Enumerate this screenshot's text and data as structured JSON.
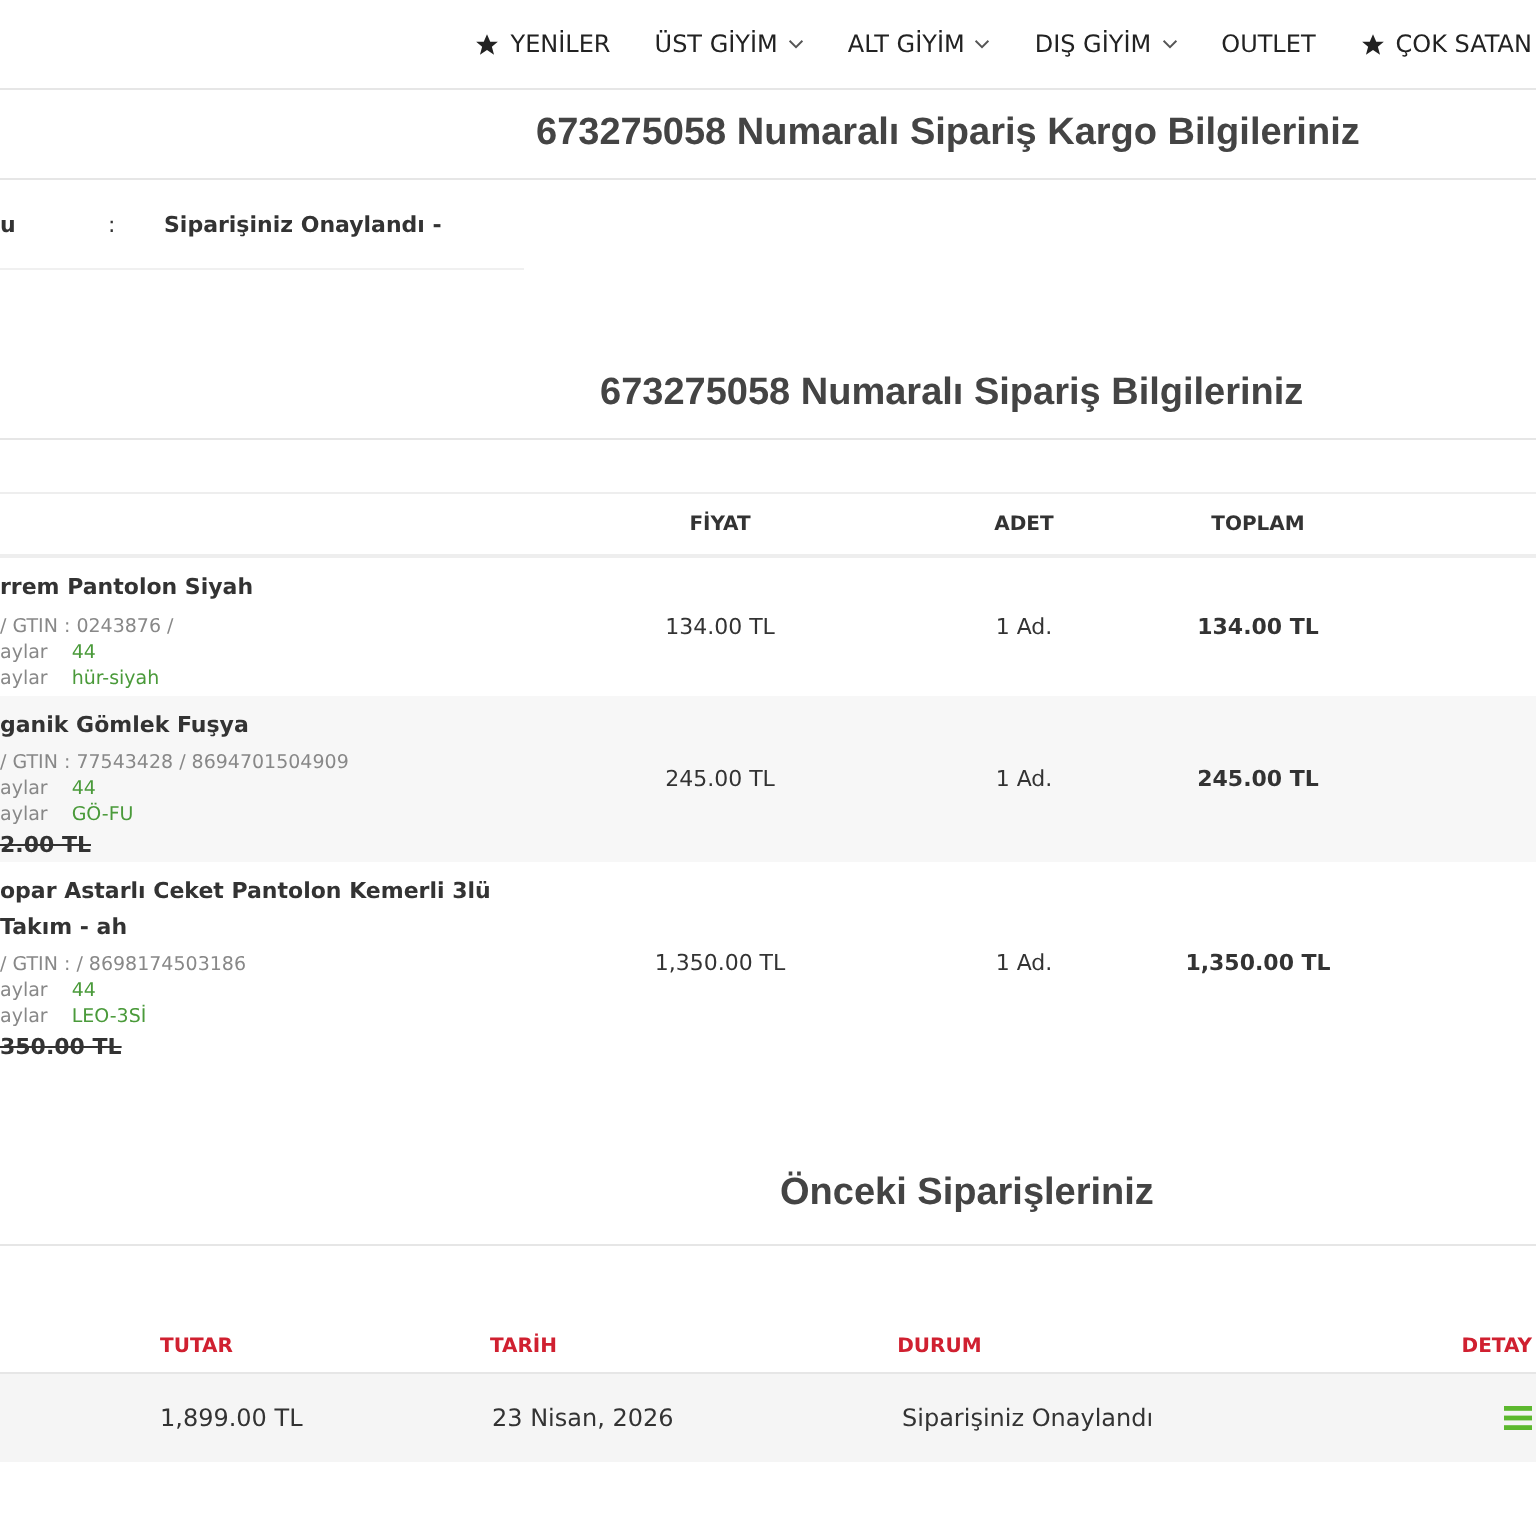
{
  "nav": [
    {
      "label": "YENİLER",
      "kind": "star"
    },
    {
      "label": "ÜST GİYİM",
      "kind": "dropdown"
    },
    {
      "label": "ALT GİYİM",
      "kind": "dropdown"
    },
    {
      "label": "DIŞ GİYİM",
      "kind": "dropdown"
    },
    {
      "label": "OUTLET",
      "kind": "plain"
    },
    {
      "label": "ÇOK SATAN",
      "kind": "star"
    }
  ],
  "cargo": {
    "title": "673275058 Numaralı Sipariş Kargo Bilgileriniz",
    "label": "u",
    "separator": ":",
    "value": "Siparişiniz Onaylandı -"
  },
  "order": {
    "title": "673275058 Numaralı Sipariş Bilgileriniz",
    "columns": [
      "FİYAT",
      "ADET",
      "TOPLAM"
    ],
    "rows": [
      {
        "name": "rrem Pantolon Siyah",
        "code": "/ GTIN : 0243876 /",
        "attributes": [
          {
            "label": "aylar",
            "value": "44"
          },
          {
            "label": "aylar",
            "value": "hür-siyah"
          }
        ],
        "old_price": "",
        "price": "134.00 TL",
        "qty": "1 Ad.",
        "total": "134.00 TL"
      },
      {
        "name": "ganik Gömlek Fuşya",
        "code": "/ GTIN : 77543428 / 8694701504909",
        "attributes": [
          {
            "label": "aylar",
            "value": "44"
          },
          {
            "label": "aylar",
            "value": "GÖ-FU"
          }
        ],
        "old_price": "2.00 TL",
        "price": "245.00 TL",
        "qty": "1 Ad.",
        "total": "245.00 TL"
      },
      {
        "name": "opar Astarlı Ceket Pantolon Kemerli 3lü Takım - ah",
        "code": "/ GTIN : / 8698174503186",
        "attributes": [
          {
            "label": "aylar",
            "value": "44"
          },
          {
            "label": "aylar",
            "value": "LEO-3Sİ"
          }
        ],
        "old_price": "350.00 TL",
        "price": "1,350.00 TL",
        "qty": "1 Ad.",
        "total": "1,350.00 TL"
      }
    ]
  },
  "previous": {
    "title": "Önceki Siparişleriniz",
    "columns": [
      "TUTAR",
      "TARİH",
      "DURUM",
      "DETAY"
    ],
    "rows": [
      {
        "amount": "1,899.00 TL",
        "date": "23 Nisan, 2026",
        "status": "Siparişiniz Onaylandı"
      }
    ]
  }
}
